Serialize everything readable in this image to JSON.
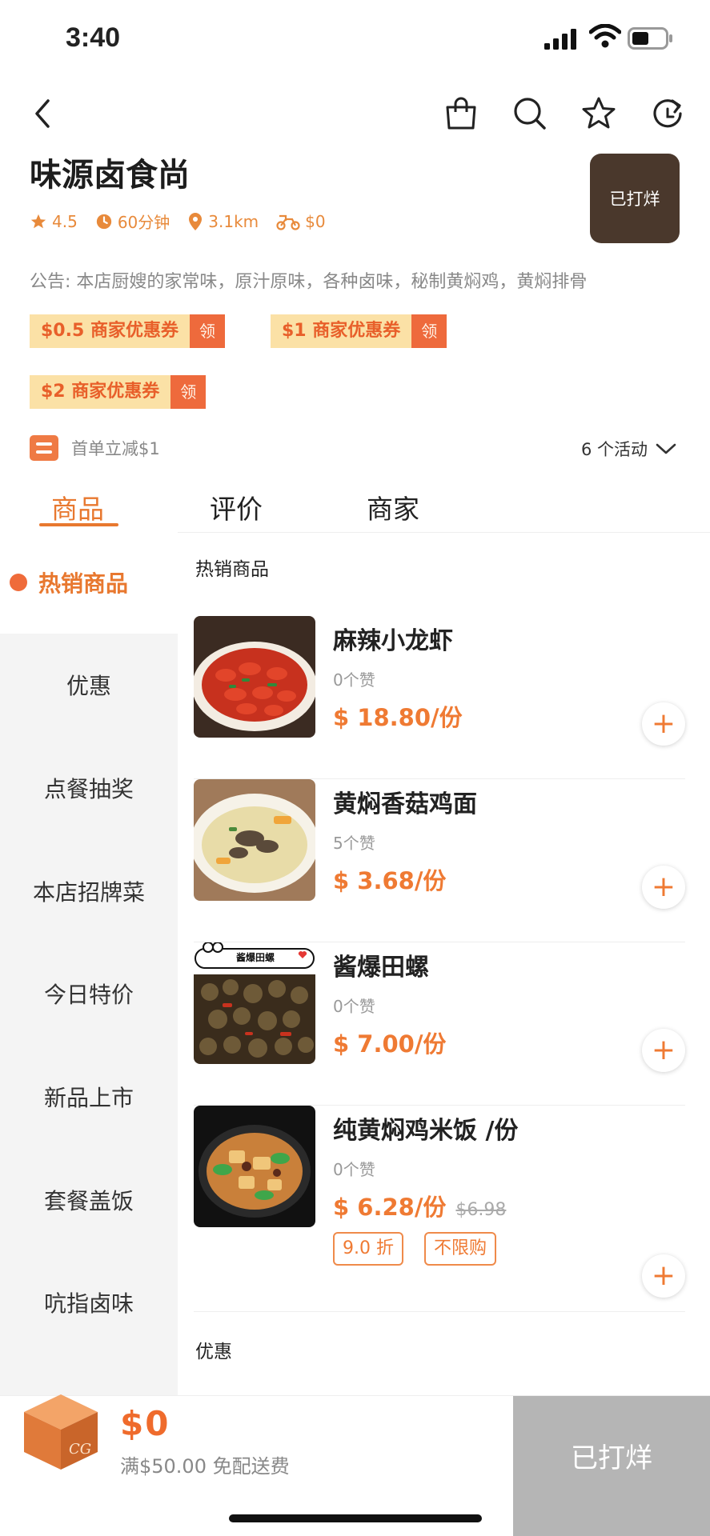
{
  "status_bar": {
    "time": "3:40"
  },
  "shop": {
    "name": "味源卤食尚",
    "logo_text": "已打烊",
    "rating": "4.5",
    "delivery_time": "60分钟",
    "distance": "3.1km",
    "delivery_fee": "$0",
    "notice": "公告: 本店厨嫂的家常味，原汁原味，各种卤味，秘制黄焖鸡，黄焖排骨"
  },
  "coupons": [
    {
      "label": "$0.5 商家优惠券",
      "action": "领"
    },
    {
      "label": "$1 商家优惠券",
      "action": "领"
    },
    {
      "label": "$2 商家优惠券",
      "action": "领"
    }
  ],
  "promo": {
    "text": "首单立减$1",
    "activities": "6 个活动"
  },
  "tabs": [
    "商品",
    "评价",
    "商家"
  ],
  "sidebar": [
    "热销商品",
    "优惠",
    "点餐抽奖",
    "本店招牌菜",
    "今日特价",
    "新品上市",
    "套餐盖饭",
    "吭指卤味"
  ],
  "sections": {
    "hot": "热销商品",
    "discount": "优惠"
  },
  "foods": [
    {
      "name": "麻辣小龙虾",
      "likes": "0个赞",
      "price": "$ 18.80/份"
    },
    {
      "name": "黄焖香菇鸡面",
      "likes": "5个赞",
      "price": "$ 3.68/份"
    },
    {
      "name": "酱爆田螺",
      "likes": "0个赞",
      "price": "$ 7.00/份",
      "banner": "酱爆田螺"
    },
    {
      "name": "纯黄焖鸡米饭 /份",
      "likes": "0个赞",
      "price": "$ 6.28/份",
      "old_price": "$6.98",
      "tags": [
        "9.0 折",
        "不限购"
      ]
    }
  ],
  "add_label": "+",
  "cart": {
    "total": "$0",
    "shipping": "满$50.00 免配送费",
    "box_text": "CG",
    "checkout": "已打烊"
  },
  "colors": {
    "accent": "#e8782f",
    "price": "#ef7a33",
    "coupon_bg": "#fbe1a6",
    "coupon_btn": "#ee6a3c",
    "checkout_bg": "#b5b5b5"
  }
}
